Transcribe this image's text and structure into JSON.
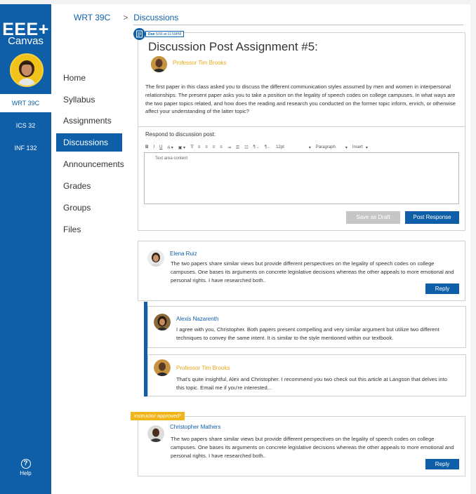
{
  "brand": {
    "title": "EEE+",
    "subtitle": "Canvas"
  },
  "global_nav": {
    "courses": [
      {
        "label": "WRT 39C",
        "active": true
      },
      {
        "label": "ICS 32",
        "active": false
      },
      {
        "label": "INF 132",
        "active": false
      }
    ],
    "help_label": "Help",
    "help_icon": "?"
  },
  "course_nav": {
    "items": [
      {
        "label": "Home"
      },
      {
        "label": "Syllabus"
      },
      {
        "label": "Assignments"
      },
      {
        "label": "Discussions",
        "active": true
      },
      {
        "label": "Announcements"
      },
      {
        "label": "Grades"
      },
      {
        "label": "Groups"
      },
      {
        "label": "Files"
      }
    ]
  },
  "breadcrumb": {
    "course": "WRT 39C",
    "separator": ">",
    "page": "Discussions"
  },
  "assignment": {
    "due_label": "Due",
    "due_date": "5/30 at 11:59PM",
    "title": "Discussion Post Assignment #5:",
    "author": "Professor Tim Brooks",
    "body": "The first paper in this class asked you to discuss the different communication styles assumed by men and women in interpersonal relationships. The present paper asks you to take a position on the legality of speech codes on college campuses. In what ways are the two paper topics related, and how does the reading and research you conducted on the former topic inform, enrich, or otherwise affect your understanding of the latter topic?"
  },
  "respond": {
    "label": "Respond to discussion post:",
    "toolbar": {
      "font_size": "12pt",
      "paragraph": "Paragraph",
      "insert": "Insert"
    },
    "textarea_value": "Text area content",
    "save_draft": "Save as Draft",
    "post_response": "Post Response"
  },
  "replies": [
    {
      "author": "Elena Ruiz",
      "text": "The two papers share similar views but provide different perspectives on the legality of speech codes on college campuses. One bases its arguments on concrete legislative decisions whereas the other appeals to more emotional and personal rights. I have researched both..",
      "reply_label": "Reply"
    },
    {
      "author": "Alexis Nazarenth",
      "text": "I agree with you, Christopher. Both papers present compelling and very similar argument but utilize two different techniques to convey the same intent. It is similar to the style mentioned within our textbook."
    },
    {
      "author": "Professor Tim Brooks",
      "text": "That's quite insightful, Alex and Christopher. I recommend you two check out this article at Langson that delves into this topic. Email me if you're interested..."
    },
    {
      "tag": "instructor approved*",
      "author": "Christopher Mathers",
      "text": "The two papers share similar views but provide different perspectives on the legality of speech codes on college campuses. One bases its arguments on concrete legislative decisions whereas the other appeals to more emotional and personal rights. I have researched both..",
      "reply_label": "Reply"
    }
  ],
  "colors": {
    "primary": "#0f5fa8",
    "accent": "#e9a817",
    "approved": "#f2b418",
    "disabled": "#c6c6c6"
  }
}
